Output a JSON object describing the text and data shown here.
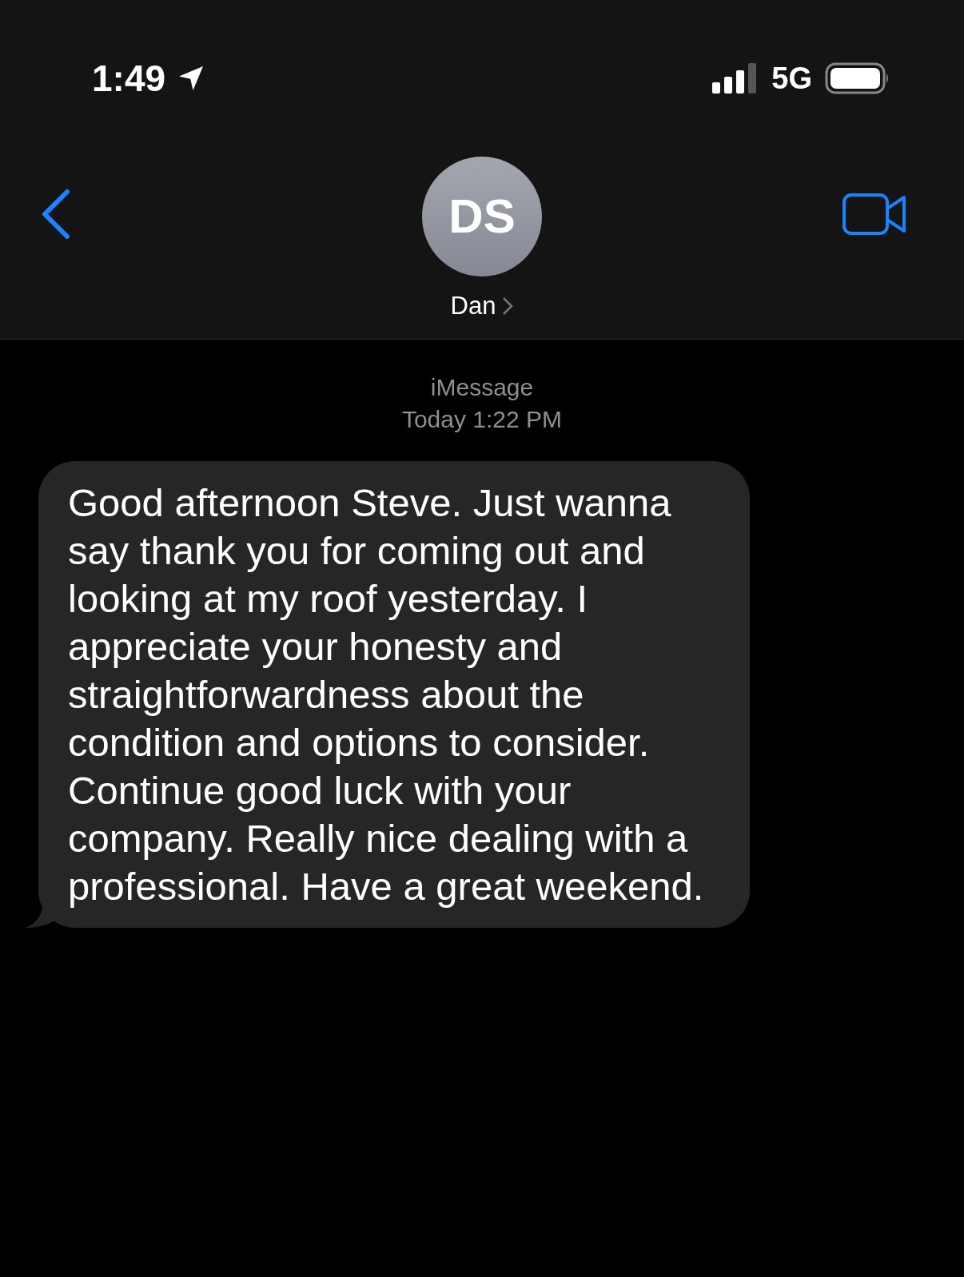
{
  "status_bar": {
    "time": "1:49",
    "network": "5G"
  },
  "header": {
    "avatar_initials": "DS",
    "contact_name": "Dan"
  },
  "conversation": {
    "service": "iMessage",
    "timestamp": "Today 1:22 PM"
  },
  "messages": [
    {
      "kind": "received",
      "text": "Good afternoon Steve. Just wanna say thank you for coming out and looking at my roof yesterday. I appreciate your honesty and straightforwardness about the condition and options to consider. Continue good luck with your company. Really nice dealing with a professional. Have a great weekend."
    }
  ]
}
